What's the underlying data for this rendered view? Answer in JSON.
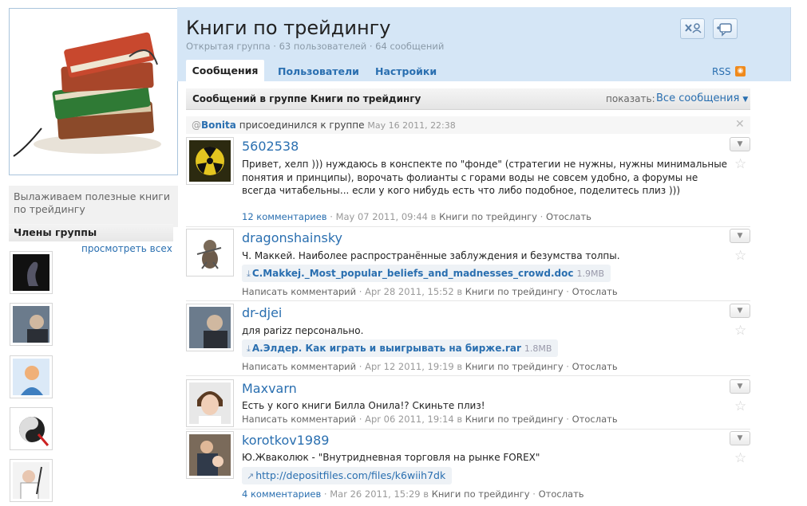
{
  "group": {
    "description": "Вылаживаем полезные книги по трейдингу",
    "members_title": "Члены группы",
    "view_all": "просмотреть всех"
  },
  "header": {
    "title": "Книги по трейдингу",
    "subline": "Открытая группа · 63 пользователей · 64 сообщений",
    "tabs": [
      "Сообщения",
      "Пользователи",
      "Настройки"
    ],
    "rss": "RSS"
  },
  "feed": {
    "title": "Сообщений в группе Книги по трейдингу",
    "show_label": "показать:",
    "filter": "Все сообщения",
    "join": {
      "at": "@",
      "name": "Bonita",
      "text": "присоединился к группе",
      "date": "May 16 2011, 22:38"
    },
    "posts": [
      {
        "author": "5602538",
        "text": "Привет, хелп ))) нуждаюсь в конспекте по \"фонде\" (стратегии не нужны, нужны минимальные понятия и принципы), ворочать фолианты с горами воды не совсем удобно, а форумы не всегда читабельны... если у кого нибудь есть что либо подобное, поделитесь плиз )))",
        "comments": "12 комментариев",
        "date": "May 07 2011, 09:44",
        "in": "в",
        "group": "Книги по трейдингу",
        "reply": "Отослать"
      },
      {
        "author": "dragonshainsky",
        "text": "Ч. Маккей. Наиболее распространённые заблуждения и безумства толпы.",
        "attachment": {
          "name": "C.Makkej._Most_popular_beliefs_and_madnesses_crowd.doc",
          "size": "1.9MB"
        },
        "comments": "Написать комментарий",
        "date": "Apr 28 2011, 15:52",
        "in": "в",
        "group": "Книги по трейдингу",
        "reply": "Отослать"
      },
      {
        "author": "dr-djei",
        "text": "для parizz персонально.",
        "attachment": {
          "name": "А.Элдер. Как играть и выигрывать на бирже.rar",
          "size": "1.8MB"
        },
        "comments": "Написать комментарий",
        "date": "Apr 12 2011, 19:19",
        "in": "в",
        "group": "Книги по трейдингу",
        "reply": "Отослать"
      },
      {
        "author": "Maxvarn",
        "text": "Есть у кого книги Билла Онила!? Скиньте плиз!",
        "comments": "Написать комментарий",
        "date": "Apr 06 2011, 19:14",
        "in": "в",
        "group": "Книги по трейдингу",
        "reply": "Отослать"
      },
      {
        "author": "korotkov1989",
        "text": "Ю.Жваколюк - \"Внутридневная торговля на рынке FOREX\"",
        "link": "http://depositfiles.com/files/k6wiih7dk",
        "comments": "4 комментариев",
        "date": "Mar 26 2011, 15:29",
        "in": "в",
        "group": "Книги по трейдингу",
        "reply": "Отослать"
      }
    ]
  },
  "colors": {
    "header_bg": "#d5e6f6",
    "link": "#2a6fb0",
    "rss": "#f08a1c"
  },
  "icons": [
    "books-logo",
    "group-members-icon",
    "add-message-icon",
    "rss-icon",
    "chevron-down-icon",
    "star-icon",
    "close-icon",
    "download-icon",
    "link-arrow-icon"
  ]
}
